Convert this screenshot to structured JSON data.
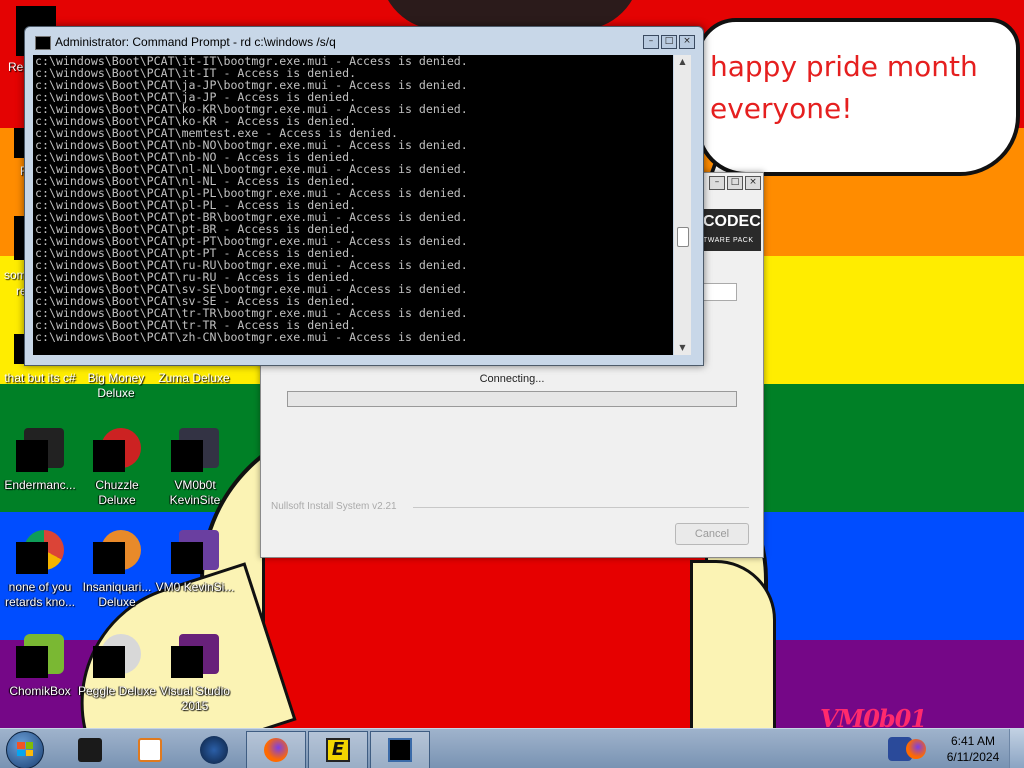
{
  "colors": {
    "pride": [
      "#e40303",
      "#ff8c00",
      "#ffed00",
      "#008026",
      "#004dff",
      "#750787"
    ],
    "bubble_text": "#e51f1f",
    "console_bg": "#000000",
    "console_text": "#c0c0c0",
    "taskbar": "#7892b2"
  },
  "bubble": {
    "line1": "happy pride month",
    "line2": "everyone!"
  },
  "watermark": "VM0b01",
  "desktop": {
    "edge_fragments": [
      "Rec",
      "F",
      "som",
      "re"
    ],
    "icons": [
      {
        "label": "that but its c#",
        "icon": "folder-icon"
      },
      {
        "label": "Big Money Deluxe",
        "icon": "game-icon"
      },
      {
        "label": "Zuma Deluxe",
        "icon": "game-icon"
      },
      {
        "label": "Endermanc...",
        "icon": "terminal-icon"
      },
      {
        "label": "Chuzzle Deluxe",
        "icon": "game-icon"
      },
      {
        "label": "VM0b0t KevinSite",
        "icon": "folder-icon"
      },
      {
        "label": "none of you retards kno...",
        "icon": "chrome-icon"
      },
      {
        "label": "Insaniquari... Deluxe",
        "icon": "fish-icon"
      },
      {
        "label": "VM0 KevinSi...",
        "icon": "folder-icon"
      },
      {
        "label": "ChomikBox",
        "icon": "hamster-icon"
      },
      {
        "label": "Peggle Deluxe",
        "icon": "game-icon"
      },
      {
        "label": "Visual Studio 2015",
        "icon": "visual-studio-icon"
      }
    ]
  },
  "installer": {
    "banner_title": "CODEC",
    "banner_sub": "TWARE PACK",
    "status": "Connecting...",
    "progress": 0.0,
    "branding": "Nullsoft Install System v2.21",
    "cancel_label": "Cancel"
  },
  "cmd": {
    "title": "Administrator: Command Prompt - rd  c:\\windows /s/q",
    "lines": [
      "c:\\windows\\Boot\\PCAT\\it-IT\\bootmgr.exe.mui - Access is denied.",
      "c:\\windows\\Boot\\PCAT\\it-IT - Access is denied.",
      "c:\\windows\\Boot\\PCAT\\ja-JP\\bootmgr.exe.mui - Access is denied.",
      "c:\\windows\\Boot\\PCAT\\ja-JP - Access is denied.",
      "c:\\windows\\Boot\\PCAT\\ko-KR\\bootmgr.exe.mui - Access is denied.",
      "c:\\windows\\Boot\\PCAT\\ko-KR - Access is denied.",
      "c:\\windows\\Boot\\PCAT\\memtest.exe - Access is denied.",
      "c:\\windows\\Boot\\PCAT\\nb-NO\\bootmgr.exe.mui - Access is denied.",
      "c:\\windows\\Boot\\PCAT\\nb-NO - Access is denied.",
      "c:\\windows\\Boot\\PCAT\\nl-NL\\bootmgr.exe.mui - Access is denied.",
      "c:\\windows\\Boot\\PCAT\\nl-NL - Access is denied.",
      "c:\\windows\\Boot\\PCAT\\pl-PL\\bootmgr.exe.mui - Access is denied.",
      "c:\\windows\\Boot\\PCAT\\pl-PL - Access is denied.",
      "c:\\windows\\Boot\\PCAT\\pt-BR\\bootmgr.exe.mui - Access is denied.",
      "c:\\windows\\Boot\\PCAT\\pt-BR - Access is denied.",
      "c:\\windows\\Boot\\PCAT\\pt-PT\\bootmgr.exe.mui - Access is denied.",
      "c:\\windows\\Boot\\PCAT\\pt-PT - Access is denied.",
      "c:\\windows\\Boot\\PCAT\\ru-RU\\bootmgr.exe.mui - Access is denied.",
      "c:\\windows\\Boot\\PCAT\\ru-RU - Access is denied.",
      "c:\\windows\\Boot\\PCAT\\sv-SE\\bootmgr.exe.mui - Access is denied.",
      "c:\\windows\\Boot\\PCAT\\sv-SE - Access is denied.",
      "c:\\windows\\Boot\\PCAT\\tr-TR\\bootmgr.exe.mui - Access is denied.",
      "c:\\windows\\Boot\\PCAT\\tr-TR - Access is denied.",
      "c:\\windows\\Boot\\PCAT\\zh-CN\\bootmgr.exe.mui - Access is denied."
    ]
  },
  "taskbar": {
    "start_icon": "windows-start-icon",
    "pinned": [
      {
        "name": "taskbar-app-explorer",
        "icon": "folder-icon"
      },
      {
        "name": "taskbar-app-media",
        "icon": "media-player-icon"
      },
      {
        "name": "taskbar-app-globe",
        "icon": "globe-icon"
      },
      {
        "name": "taskbar-app-firefox",
        "icon": "firefox-icon"
      },
      {
        "name": "taskbar-app-e",
        "icon": "e-app-icon"
      },
      {
        "name": "taskbar-app-cmd",
        "icon": "cmd-icon"
      }
    ],
    "time": "6:41 AM",
    "date": "6/11/2024"
  }
}
